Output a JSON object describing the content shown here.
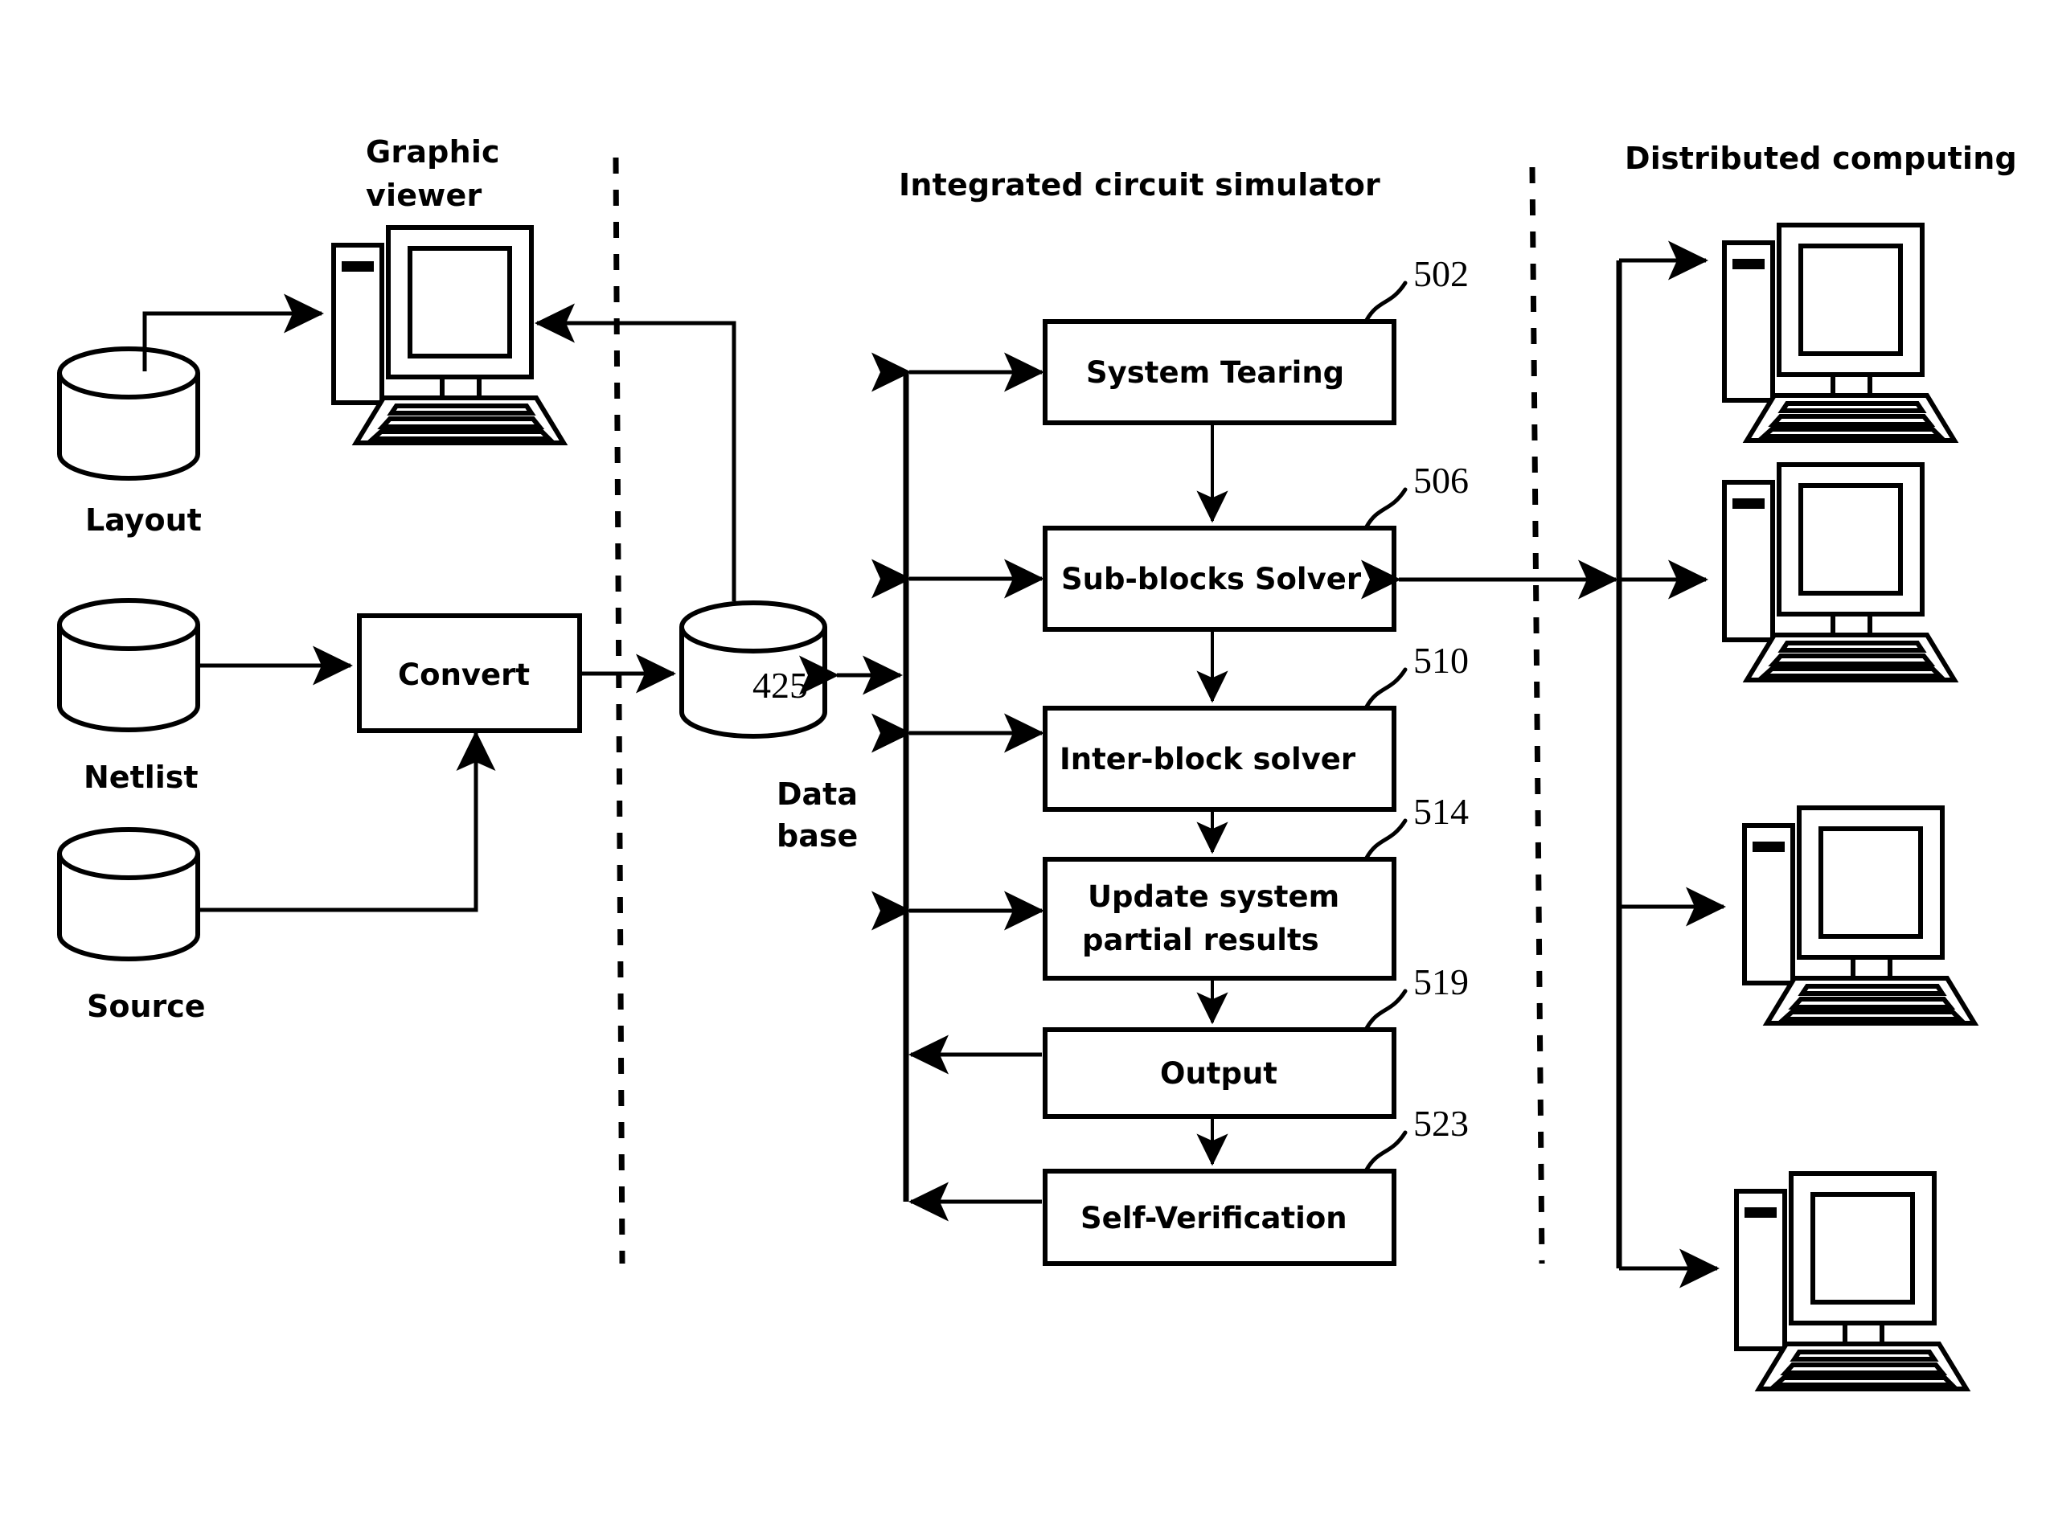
{
  "figure": {
    "type": "patent-block-diagram",
    "background": "#ffffff",
    "line_color": "#000000"
  },
  "sections": {
    "graphic_viewer": {
      "title_line1": "Graphic",
      "title_line2": "viewer"
    },
    "simulator": {
      "title": "Integrated circuit simulator"
    },
    "distributed": {
      "title": "Distributed computing"
    }
  },
  "inputs": [
    {
      "id": "layout",
      "label": "Layout",
      "shape": "cylinder"
    },
    {
      "id": "netlist",
      "label": "Netlist",
      "shape": "cylinder"
    },
    {
      "id": "source",
      "label": "Source",
      "shape": "cylinder"
    }
  ],
  "convert": {
    "label": "Convert",
    "shape": "rect"
  },
  "database": {
    "ref": "425",
    "label_line1": "Data",
    "label_line2": "base",
    "shape": "cylinder"
  },
  "process_boxes": [
    {
      "id": "system-tearing",
      "label": "System Tearing",
      "label2": "",
      "ref": "502",
      "arrow": "double"
    },
    {
      "id": "sub-blocks-solver",
      "label": "Sub-blocks Solver",
      "label2": "",
      "ref": "506",
      "arrow": "double"
    },
    {
      "id": "inter-block-solver",
      "label": "Inter-block solver",
      "label2": "",
      "ref": "510",
      "arrow": "double"
    },
    {
      "id": "update-system",
      "label": "Update system",
      "label2": "partial results",
      "ref": "514",
      "arrow": "double"
    },
    {
      "id": "output",
      "label": "Output",
      "label2": "",
      "ref": "519",
      "arrow": "left"
    },
    {
      "id": "self-verification",
      "label": "Self-Verification",
      "label2": "",
      "ref": "523",
      "arrow": "left"
    }
  ],
  "distributed_nodes": [
    {
      "id": "node-1",
      "icon": "desktop-computer-icon"
    },
    {
      "id": "node-2",
      "icon": "desktop-computer-icon"
    },
    {
      "id": "node-3",
      "icon": "desktop-computer-icon"
    },
    {
      "id": "node-4",
      "icon": "desktop-computer-icon"
    }
  ],
  "viewer_node": {
    "id": "graphic-viewer-node",
    "icon": "desktop-computer-icon"
  },
  "dividers": [
    {
      "id": "divider-left",
      "style": "dashed-vertical"
    },
    {
      "id": "divider-right",
      "style": "dashed-vertical"
    }
  ]
}
